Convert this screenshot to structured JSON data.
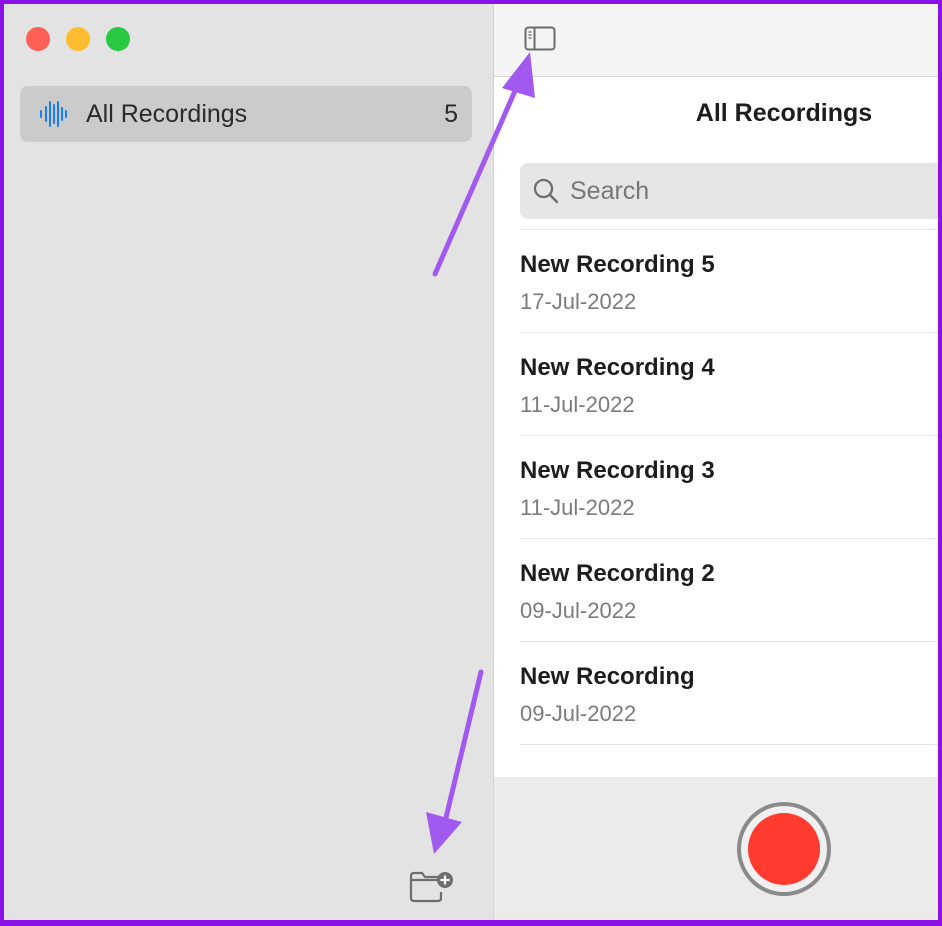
{
  "window": {
    "traffic_lights": [
      "close",
      "minimize",
      "zoom"
    ]
  },
  "sidebar": {
    "items": [
      {
        "label": "All Recordings",
        "count": "5",
        "icon": "waveform-icon",
        "selected": true
      }
    ],
    "footer": {
      "new_folder_icon": "new-folder-icon"
    }
  },
  "toolbar": {
    "sidebar_toggle_icon": "sidebar-toggle-icon"
  },
  "main": {
    "title": "All Recordings",
    "search": {
      "placeholder": "Search",
      "value": ""
    },
    "recordings": [
      {
        "name": "New Recording 5",
        "date": "17-Jul-2022"
      },
      {
        "name": "New Recording 4",
        "date": "11-Jul-2022"
      },
      {
        "name": "New Recording 3",
        "date": "11-Jul-2022"
      },
      {
        "name": "New Recording 2",
        "date": "09-Jul-2022"
      },
      {
        "name": "New Recording",
        "date": "09-Jul-2022"
      }
    ]
  },
  "colors": {
    "accent_blue": "#1a7ef0",
    "record_red": "#ff3b30",
    "annotation_purple": "#a259f0",
    "frame_purple": "#8a12e6"
  }
}
